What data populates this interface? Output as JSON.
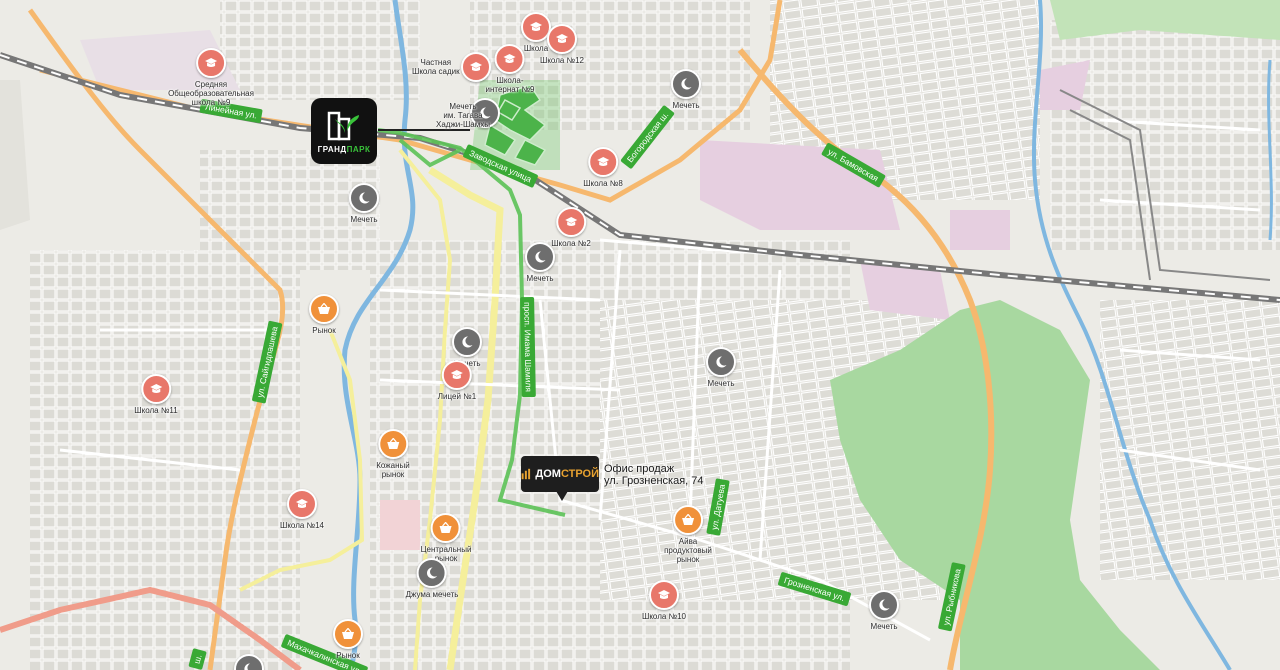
{
  "map": {
    "markers": {
      "grandpark": {
        "title_part1": "ГРАНД",
        "title_part2": "ПАРК",
        "icon": "grandpark-logo-icon"
      },
      "domstroy": {
        "title_part1": "ДОМ",
        "title_part2": "СТРОЙ",
        "icon": "domstroy-logo-icon",
        "caption_line1": "Офис продаж",
        "caption_line2": "ул. Грозненская, 74"
      }
    },
    "streets": [
      {
        "label": "Линейная ул."
      },
      {
        "label": "Заводская улица"
      },
      {
        "label": "Богородская ш."
      },
      {
        "label": "ул. Бамовская"
      },
      {
        "label": "просп. Имама Шамиля"
      },
      {
        "label": "ул. Сайгидпашева"
      },
      {
        "label": "ул. Датуева"
      },
      {
        "label": "Грозненская ул."
      },
      {
        "label": "ул. Рыбникова"
      },
      {
        "label": "Махачкалинская ул."
      },
      {
        "label": "ш."
      }
    ],
    "pois": [
      {
        "type": "school",
        "label": "Школа"
      },
      {
        "type": "school",
        "label": "Школа №12"
      },
      {
        "type": "school",
        "label": "Частная\nШкола садик"
      },
      {
        "type": "school",
        "label": "Школа-\nинтернат №9"
      },
      {
        "type": "school",
        "label": "Средняя\nОбщеобразовательная\nшкола №9"
      },
      {
        "type": "mosque",
        "label": "Мечеть\nим. Тагава\nХаджи-Шамхы"
      },
      {
        "type": "mosque",
        "label": "Мечеть"
      },
      {
        "type": "school",
        "label": "Школа №8"
      },
      {
        "type": "mosque",
        "label": "Мечеть"
      },
      {
        "type": "school",
        "label": "Школа №2"
      },
      {
        "type": "mosque",
        "label": "Мечеть"
      },
      {
        "type": "market",
        "label": "Рынок"
      },
      {
        "type": "mosque",
        "label": "Мечеть"
      },
      {
        "type": "school",
        "label": "Лицей №1"
      },
      {
        "type": "mosque",
        "label": "Мечеть"
      },
      {
        "type": "school",
        "label": "Школа №11"
      },
      {
        "type": "market",
        "label": "Кожаный\nрынок"
      },
      {
        "type": "school",
        "label": "Школа №14"
      },
      {
        "type": "market",
        "label": "Центральный\nрынок"
      },
      {
        "type": "mosque",
        "label": "Джума мечеть"
      },
      {
        "type": "market",
        "label": "Айва\nпродуктовый\nрынок"
      },
      {
        "type": "school",
        "label": "Школа №10"
      },
      {
        "type": "mosque",
        "label": "Мечеть"
      },
      {
        "type": "market",
        "label": "Рынок"
      },
      {
        "type": "mosque",
        "label": ""
      }
    ]
  }
}
